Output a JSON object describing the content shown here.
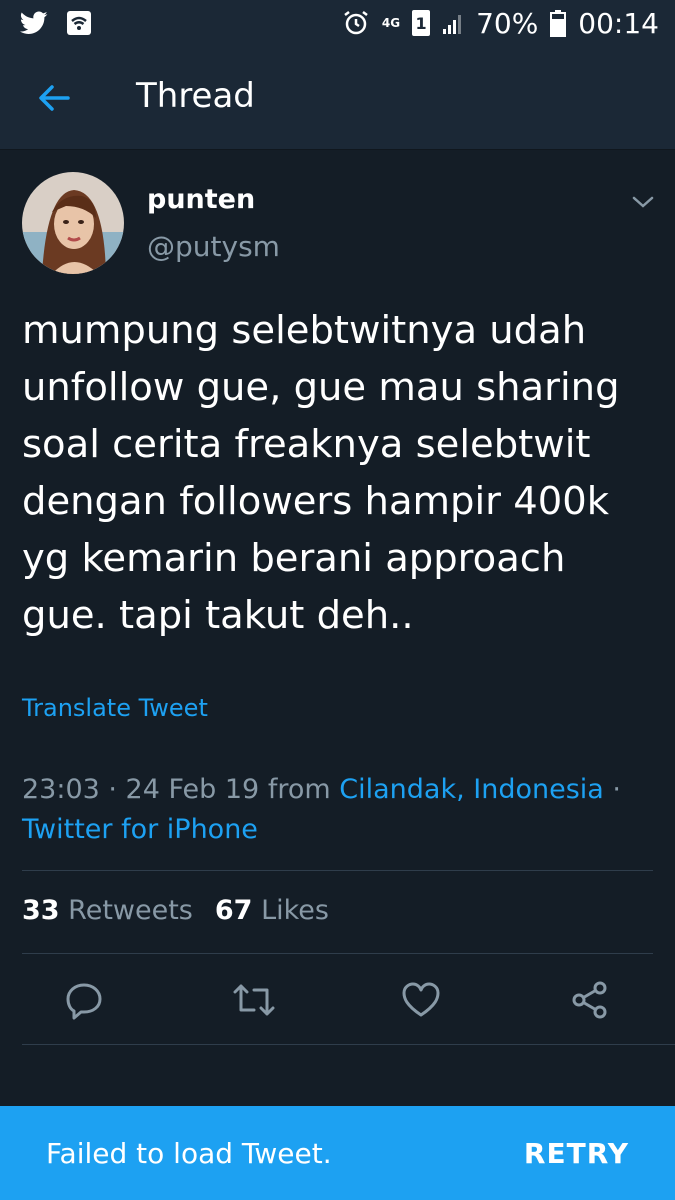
{
  "status_bar": {
    "network": "4G",
    "sim": "1",
    "battery": "70%",
    "time": "00:14",
    "icons": [
      "twitter-icon",
      "wifi-icon",
      "alarm-icon",
      "signal-icon",
      "battery-icon"
    ]
  },
  "header": {
    "title": "Thread",
    "back_icon": "arrow-left-icon"
  },
  "tweet": {
    "name": "punten",
    "handle": "@putysm",
    "text": "mumpung selebtwitnya udah unfollow gue, gue mau sharing soal cerita freaknya selebtwit dengan followers hampir 400k yg kemarin berani approach gue. tapi takut deh..",
    "translate_label": "Translate Tweet",
    "time": "23:03 · 24 Feb 19 from ",
    "location": "Cilandak, Indonesia",
    "separator": " ·",
    "source": "Twitter for iPhone",
    "retweets_count": "33",
    "retweets_label": "Retweets",
    "likes_count": "67",
    "likes_label": "Likes"
  },
  "actions": [
    "reply-icon",
    "retweet-icon",
    "like-icon",
    "share-icon"
  ],
  "snackbar": {
    "message": "Failed to load Tweet.",
    "action": "RETRY"
  },
  "colors": {
    "background": "#141d26",
    "bar": "#1b2836",
    "accent": "#1da1f2",
    "muted": "#8899a6"
  }
}
